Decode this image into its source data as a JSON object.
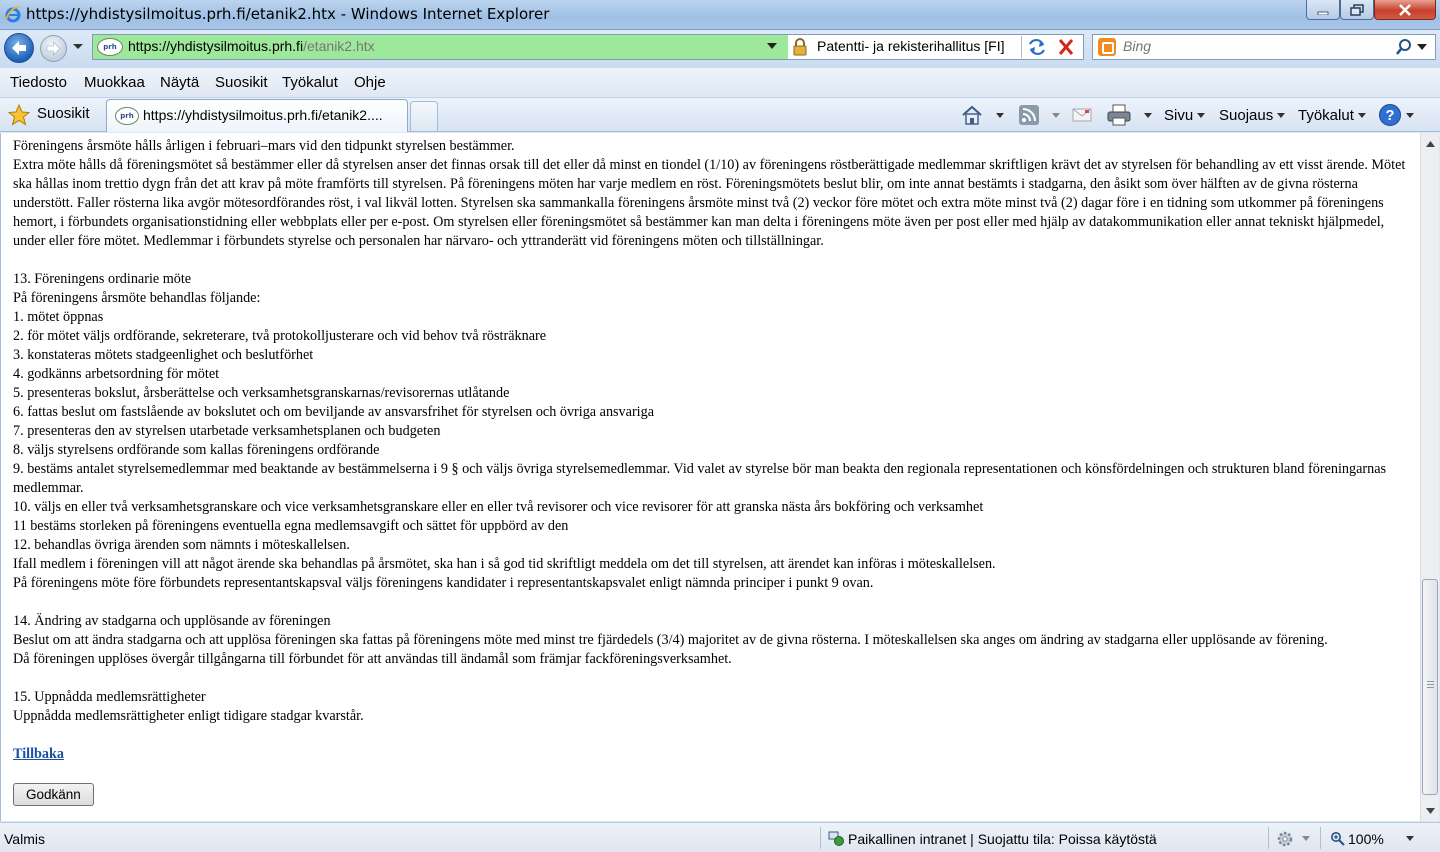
{
  "window": {
    "title": "https://yhdistysilmoitus.prh.fi/etanik2.htx - Windows Internet Explorer"
  },
  "address_bar": {
    "url_host": "https://yhdistysilmoitus.prh.fi",
    "url_path": "/etanik2.htx",
    "site_identity": "Patentti- ja rekisterihallitus [FI]"
  },
  "search": {
    "placeholder": "Bing"
  },
  "menu": [
    "Tiedosto",
    "Muokkaa",
    "Näytä",
    "Suosikit",
    "Työkalut",
    "Ohje"
  ],
  "favorites_bar": {
    "label": "Suosikit",
    "tab_title": "https://yhdistysilmoitus.prh.fi/etanik2....",
    "favicon_text": "prh"
  },
  "command_bar": {
    "page": "Sivu",
    "security": "Suojaus",
    "tools": "Työkalut"
  },
  "content": {
    "paragraphs_top": [
      "Föreningens årsmöte hålls årligen i februari–mars vid den tidpunkt styrelsen bestämmer.",
      "Extra möte hålls då föreningsmötet så bestämmer eller då styrelsen anser det finnas orsak till det eller då minst en tiondel (1/10) av föreningens röstberättigade medlemmar skriftligen krävt det av styrelsen för behandling av ett visst ärende. Mötet ska hållas inom trettio dygn från det att krav på möte framförts till styrelsen. På föreningens möten har varje medlem en röst. Föreningsmötets beslut blir, om inte annat bestämts i stadgarna, den åsikt som över hälften av de givna rösterna understött. Faller rösterna lika avgör mötesordförandes röst, i val likväl lotten. Styrelsen ska sammankalla föreningens årsmöte minst två (2) veckor före mötet och extra möte minst två (2) dagar före i en tidning som utkommer på föreningens hemort, i förbundets organisationstidning eller webbplats eller per e-post. Om styrelsen eller föreningsmötet så bestämmer kan man delta i föreningens möte även per post eller med hjälp av datakommunikation eller annat tekniskt hjälpmedel, under eller före mötet. Medlemmar i förbundets styrelse och personalen har närvaro- och yttranderätt vid föreningens möten och tillställningar."
    ],
    "section13_title": "13. Föreningens ordinarie möte",
    "section13_intro": "På föreningens årsmöte behandlas följande:",
    "section13_items": [
      "1. mötet öppnas",
      "2. för mötet väljs ordförande, sekreterare, två protokolljusterare och vid behov två rösträknare",
      "3. konstateras mötets stadgeenlighet och beslutförhet",
      "4. godkänns arbetsordning för mötet",
      "5. presenteras bokslut, årsberättelse och verksamhetsgranskarnas/revisorernas utlåtande",
      "6. fattas beslut om fastslående av bokslutet och om beviljande av ansvarsfrihet för styrelsen och övriga ansvariga",
      "7. presenteras den av styrelsen utarbetade verksamhetsplanen och budgeten",
      "8. väljs styrelsens ordförande som kallas föreningens ordförande",
      "9. bestäms antalet styrelsemedlemmar med beaktande av bestämmelserna i 9 § och väljs övriga styrelsemedlemmar. Vid valet av styrelse bör man beakta den regionala representationen och könsfördelningen och strukturen bland föreningarnas medlemmar.",
      "10. väljs en eller två verksamhetsgranskare och vice verksamhetsgranskare eller en eller två revisorer och vice revisorer för att granska nästa års bokföring och verksamhet",
      "11 bestäms storleken på föreningens eventuella egna medlemsavgift och sättet för uppbörd av den",
      "12. behandlas övriga ärenden som nämnts i möteskallelsen.",
      "Ifall medlem i föreningen vill att något ärende ska behandlas på årsmötet, ska han i så god tid skriftligt meddela om det till styrelsen, att ärendet kan införas i möteskallelsen.",
      "På föreningens möte före förbundets representantskapsval väljs föreningens kandidater i representantskapsvalet enligt nämnda principer i punkt 9 ovan."
    ],
    "section14_title": "14. Ändring av stadgarna och upplösande av föreningen",
    "section14_text": [
      "Beslut om att ändra stadgarna och att upplösa föreningen ska fattas på föreningens möte med minst tre fjärdedels (3/4) majoritet av de givna rösterna. I möteskallelsen ska anges om ändring av stadgarna eller upplösande av förening.",
      "Då föreningen upplöses övergår tillgångarna till förbundet för att användas till ändamål som främjar fackföreningsverksamhet."
    ],
    "section15_title": "15. Uppnådda medlemsrättigheter",
    "section15_text": "Uppnådda medlemsrättigheter enligt tidigare stadgar kvarstår.",
    "back_link": "Tillbaka",
    "approve_button": "Godkänn"
  },
  "status_bar": {
    "status": "Valmis",
    "zone": "Paikallinen intranet | Suojattu tila: Poissa käytöstä",
    "zoom": "100%"
  }
}
